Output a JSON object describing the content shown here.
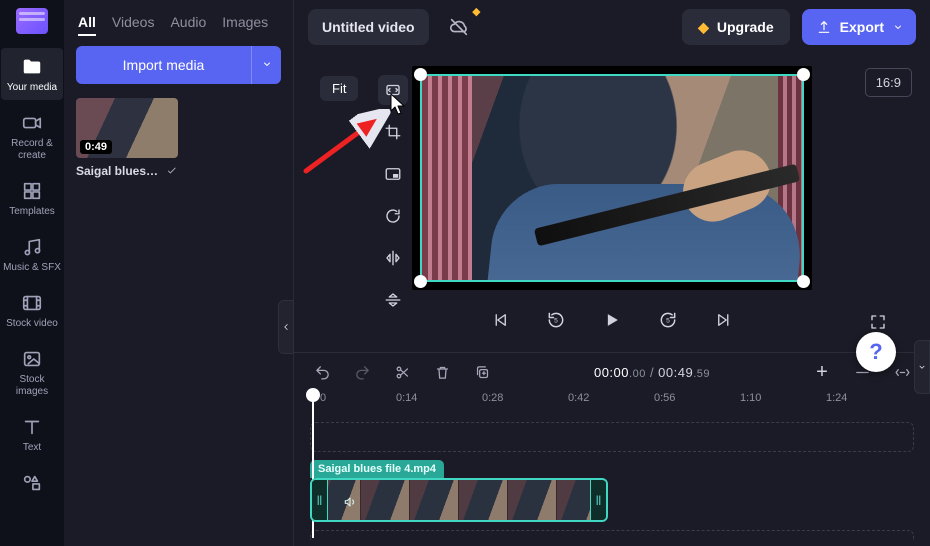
{
  "rail": {
    "your_media": "Your media",
    "record_create": "Record &\ncreate",
    "templates": "Templates",
    "music_sfx": "Music & SFX",
    "stock_video": "Stock video",
    "stock_images": "Stock\nimages",
    "text": "Text"
  },
  "media_tabs": {
    "all": "All",
    "videos": "Videos",
    "audio": "Audio",
    "images": "Images"
  },
  "import_label": "Import media",
  "clip": {
    "duration": "0:49",
    "name": "Saigal blues f..."
  },
  "title": "Untitled video",
  "upgrade": "Upgrade",
  "export": "Export",
  "aspect_ratio": "16:9",
  "fit_tooltip": "Fit",
  "timecode": {
    "current": "00:00",
    "current_frac": ".00",
    "total": "00:49",
    "total_frac": ".59",
    "sep": " / "
  },
  "ruler_marks": [
    "0",
    "0:14",
    "0:28",
    "0:42",
    "0:56",
    "1:10",
    "1:24"
  ],
  "timeline_clip_label": "Saigal blues file 4.mp4",
  "help_symbol": "?"
}
